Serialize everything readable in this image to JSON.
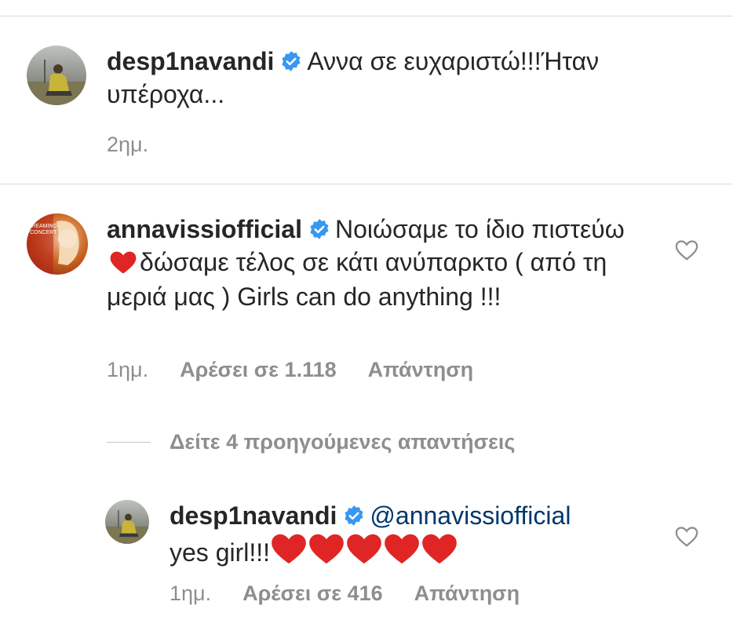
{
  "comments": [
    {
      "username": "desp1navandi",
      "text": "Αννα σε ευχαριστώ!!!Ήταν υπέροχα...",
      "time": "2ημ."
    },
    {
      "username": "annavissiofficial",
      "text_part1": "Νοιώσαμε το ίδιο πιστεύω",
      "text_part2": "δώσαμε τέλος σε κάτι ανύπαρκτο ( από τη μεριά μας )  Girls can do anything !!!",
      "time": "1ημ.",
      "likes": "Αρέσει σε 1.118",
      "reply": "Απάντηση",
      "avatar_text": "STREAMING CONCERT"
    }
  ],
  "view_replies": "Δείτε 4 προηγούμενες απαντήσεις",
  "reply": {
    "username": "desp1navandi",
    "mention": "@annavissiofficial",
    "text": "yes girl!!!",
    "time": "1ημ.",
    "likes": "Αρέσει σε 416",
    "reply": "Απάντηση"
  },
  "colors": {
    "verified": "#3897f0",
    "heart": "#ed4956",
    "meta": "#8e8e8e",
    "mention": "#00376b"
  },
  "icons": [
    "verified-badge-icon",
    "heart-outline-icon",
    "red-heart-emoji"
  ]
}
